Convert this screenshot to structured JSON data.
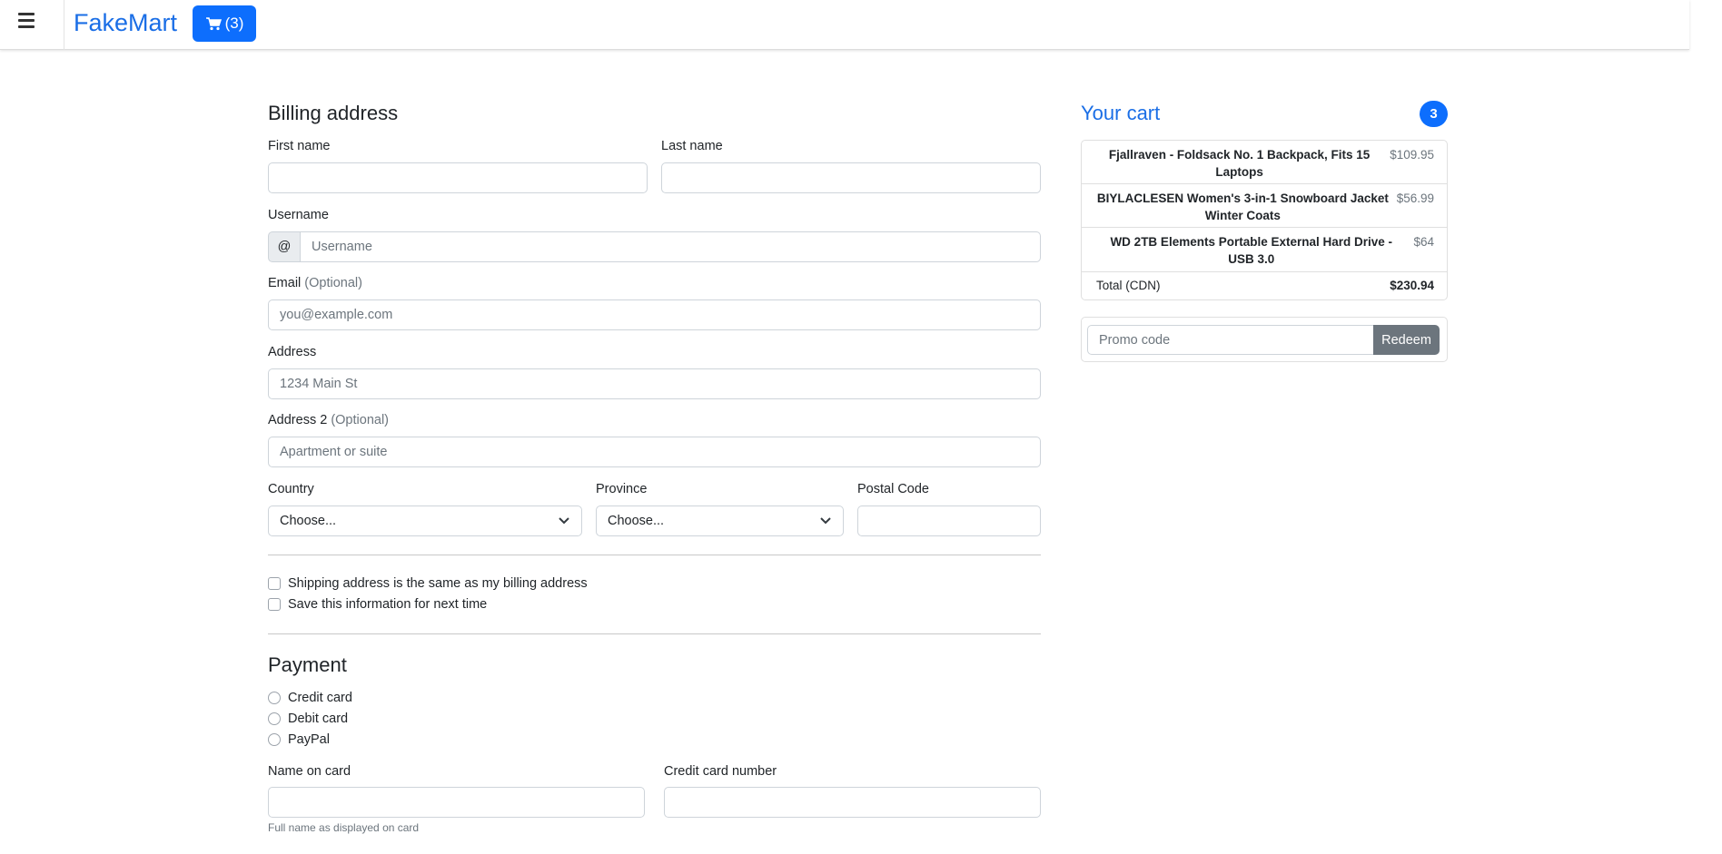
{
  "navbar": {
    "brand": "FakeMart",
    "cart_label": "(3)",
    "icons": {
      "menu": "hamburger-icon",
      "cart": "cart-icon"
    },
    "accent": "#0d6efd"
  },
  "billing": {
    "title": "Billing address",
    "first_name": {
      "label": "First name",
      "value": ""
    },
    "last_name": {
      "label": "Last name",
      "value": ""
    },
    "username": {
      "label": "Username",
      "prefix": "@",
      "placeholder": "Username"
    },
    "email": {
      "label": "Email",
      "optional": "(Optional)",
      "placeholder": "you@example.com"
    },
    "address": {
      "label": "Address",
      "placeholder": "1234 Main St"
    },
    "address2": {
      "label": "Address 2",
      "optional": "(Optional)",
      "placeholder": "Apartment or suite"
    },
    "country": {
      "label": "Country",
      "selected": "Choose..."
    },
    "province": {
      "label": "Province",
      "selected": "Choose..."
    },
    "postal": {
      "label": "Postal Code",
      "value": ""
    },
    "same_address": "Shipping address is the same as my billing address",
    "save_info": "Save this information for next time"
  },
  "payment": {
    "title": "Payment",
    "methods": [
      "Credit card",
      "Debit card",
      "PayPal"
    ],
    "name_on_card": {
      "label": "Name on card",
      "help": "Full name as displayed on card"
    },
    "cc_number": {
      "label": "Credit card number"
    }
  },
  "cart": {
    "title": "Your cart",
    "count": "3",
    "items": [
      {
        "name": "Fjallraven - Foldsack No. 1 Backpack, Fits 15 Laptops",
        "price": "$109.95"
      },
      {
        "name": "BIYLACLESEN Women's 3-in-1 Snowboard Jacket Winter Coats",
        "price": "$56.99"
      },
      {
        "name": "WD 2TB Elements Portable External Hard Drive - USB 3.0",
        "price": "$64"
      }
    ],
    "total_label": "Total (CDN)",
    "total": "$230.94",
    "promo_placeholder": "Promo code",
    "redeem": "Redeem"
  }
}
